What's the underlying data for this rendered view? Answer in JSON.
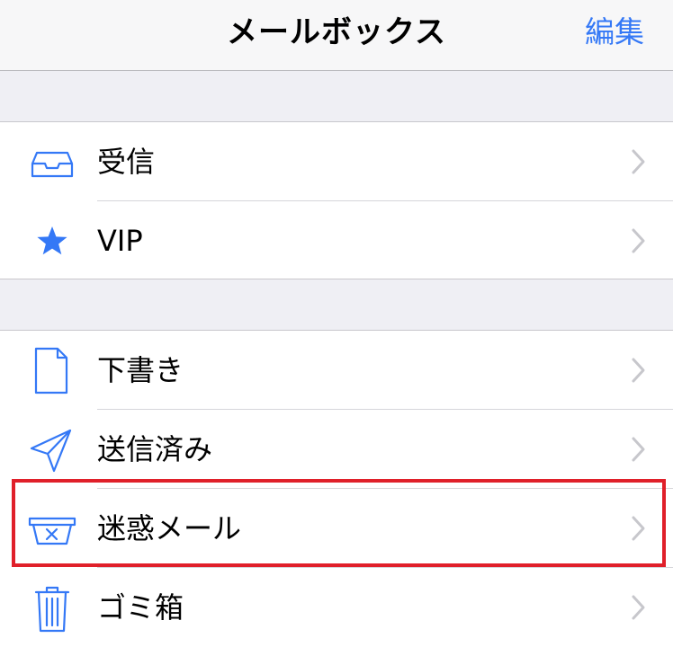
{
  "navbar": {
    "title": "メールボックス",
    "edit_label": "編集"
  },
  "accent_color": "#3478f6",
  "highlight_color": "#e0202a",
  "mailboxes_primary": [
    {
      "label": "受信",
      "icon": "inbox-tray-icon"
    },
    {
      "label": "VIP",
      "icon": "star-icon"
    }
  ],
  "mailboxes_secondary": [
    {
      "label": "下書き",
      "icon": "document-icon"
    },
    {
      "label": "送信済み",
      "icon": "paper-plane-icon"
    },
    {
      "label": "迷惑メール",
      "icon": "junk-box-icon",
      "highlighted": true
    },
    {
      "label": "ゴミ箱",
      "icon": "trash-icon"
    }
  ]
}
